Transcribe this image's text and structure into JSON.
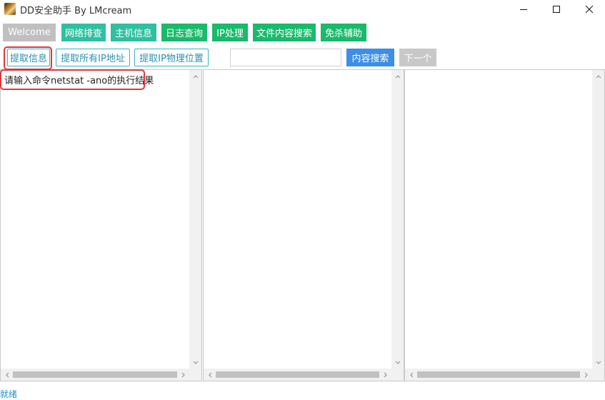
{
  "window": {
    "title": "DD安全助手 By LMcream"
  },
  "top_toolbar": {
    "items": [
      {
        "label": "Welcome"
      },
      {
        "label": "网络排查"
      },
      {
        "label": "主机信息"
      },
      {
        "label": "日志查询"
      },
      {
        "label": "IP处理"
      },
      {
        "label": "文件内容搜索"
      },
      {
        "label": "免杀辅助"
      }
    ]
  },
  "sub_toolbar": {
    "extract_info_label": "提取信息",
    "extract_all_ip_label": "提取所有IP地址",
    "extract_ip_location_label": "提取IP物理位置",
    "search": {
      "value": "",
      "placeholder": ""
    },
    "content_search_label": "内容搜索",
    "next_label": "下一个"
  },
  "panes": {
    "left": {
      "text": "请输入命令netstat -ano的执行结果"
    },
    "middle": {
      "text": ""
    },
    "right": {
      "text": ""
    }
  },
  "status": {
    "text": "就绪"
  },
  "colors": {
    "welcome": "#c0c0c0",
    "green": "#1aba6c",
    "teal": "#2ec0a0",
    "blue_button": "#3c8ee6",
    "highlight_red": "#e0383c",
    "status_text": "#1f8fcf"
  },
  "icons": [
    "app-icon",
    "minimize-icon",
    "maximize-icon",
    "close-icon",
    "scroll-up-icon",
    "scroll-down-icon",
    "scroll-left-icon",
    "scroll-right-icon"
  ]
}
